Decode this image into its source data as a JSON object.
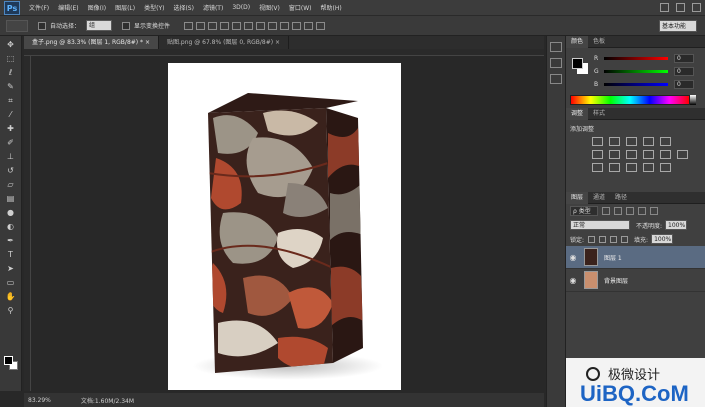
{
  "menubar": {
    "logo": "Ps",
    "items": [
      "文件(F)",
      "编辑(E)",
      "图像(I)",
      "图层(L)",
      "类型(Y)",
      "选择(S)",
      "滤镜(T)",
      "3D(D)",
      "视图(V)",
      "窗口(W)",
      "帮助(H)"
    ]
  },
  "options": {
    "auto_select_label": "自动选择：",
    "auto_select_value": "组",
    "transform_label": "显示变换控件",
    "workspace": "基本功能"
  },
  "tabs": [
    {
      "label": "盒子.png @ 83.3% (图层 1, RGB/8#) * ×"
    },
    {
      "label": "贴图.png @ 67.8% (图层 0, RGB/8#) ×"
    }
  ],
  "status": {
    "zoom": "83.29%",
    "doc_size": "文档:1.60M/2.34M"
  },
  "color_panel": {
    "tabs": [
      "颜色",
      "色板"
    ],
    "sliders": [
      {
        "label": "R",
        "value": "0",
        "gradient": "linear-gradient(90deg,#000,#f00)"
      },
      {
        "label": "G",
        "value": "0",
        "gradient": "linear-gradient(90deg,#000,#0f0)"
      },
      {
        "label": "B",
        "value": "0",
        "gradient": "linear-gradient(90deg,#000,#00f)"
      }
    ]
  },
  "adjust_panel": {
    "tabs": [
      "调整",
      "样式"
    ],
    "title": "添加调整"
  },
  "layers_panel": {
    "tabs": [
      "图层",
      "通道",
      "路径"
    ],
    "kind": "ρ 类型",
    "blend_mode": "正常",
    "opacity_label": "不透明度:",
    "opacity": "100%",
    "lock_label": "锁定:",
    "fill_label": "填充:",
    "fill": "100%",
    "layers": [
      {
        "name": "图层 1",
        "selected": true
      },
      {
        "name": "背景图层",
        "selected": false
      }
    ]
  },
  "watermark": {
    "text": "极微设计",
    "url": "UiBQ.CoM"
  },
  "colors": {
    "accent": "#5a6b82",
    "brand_blue": "#1d64c4",
    "wood_dark": "#3a221c",
    "leaf_red": "#b0492f",
    "leaf_gray": "#9c9487"
  }
}
